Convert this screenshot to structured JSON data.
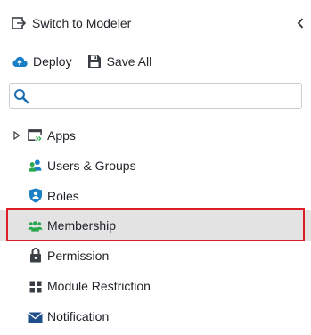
{
  "header": {
    "switch_label": "Switch to Modeler",
    "switch_icon": "exit-to-modeler-icon",
    "collapse_icon": "chevron-left-icon"
  },
  "toolbar": {
    "deploy_label": "Deploy",
    "deploy_icon": "cloud-upload-icon",
    "save_all_label": "Save All",
    "save_all_icon": "floppy-disk-icon"
  },
  "search": {
    "placeholder": "",
    "value": "",
    "icon": "search-icon"
  },
  "nav": {
    "items": [
      {
        "label": "Apps",
        "icon": "apps-window-icon",
        "expandable": true
      },
      {
        "label": "Users & Groups",
        "icon": "users-groups-icon"
      },
      {
        "label": "Roles",
        "icon": "role-shield-icon"
      },
      {
        "label": "Membership",
        "icon": "membership-people-icon",
        "selected": true
      },
      {
        "label": "Permission",
        "icon": "lock-icon"
      },
      {
        "label": "Module Restriction",
        "icon": "module-grid-icon"
      },
      {
        "label": "Notification",
        "icon": "envelope-icon"
      }
    ]
  },
  "colors": {
    "accent_blue": "#1a7fc4",
    "accent_green": "#2aa64c",
    "highlight_border": "#dc1f26",
    "selected_bg": "#e3e3e3",
    "icon_dark": "#3a3f45"
  }
}
